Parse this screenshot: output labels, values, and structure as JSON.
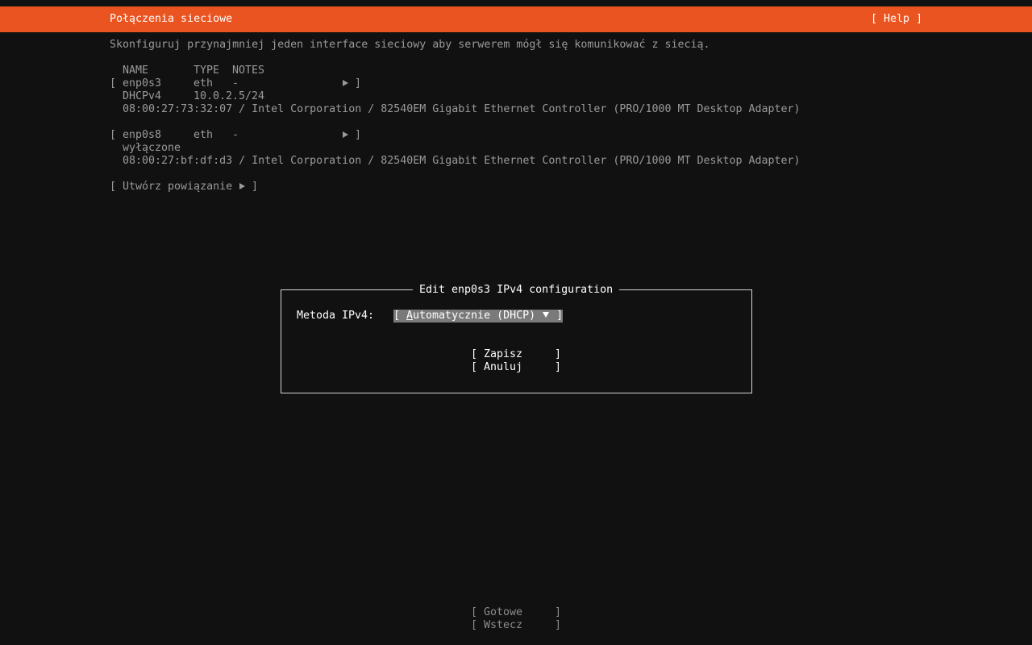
{
  "header": {
    "title": "Połączenia sieciowe",
    "help": "[ Help ]"
  },
  "intro": "Skonfiguruj przynajmniej jeden interface sieciowy aby serwerem mógł się komunikować z siecią.",
  "table": {
    "headers": [
      "NAME",
      "TYPE",
      "NOTES"
    ]
  },
  "interfaces": [
    {
      "name": "enp0s3",
      "type": "eth",
      "notes": "-",
      "addr_method": "DHCPv4",
      "addr": "10.0.2.5/24",
      "hw": "08:00:27:73:32:07 / Intel Corporation / 82540EM Gigabit Ethernet Controller (PRO/1000 MT Desktop Adapter)"
    },
    {
      "name": "enp0s8",
      "type": "eth",
      "notes": "-",
      "status": "wyłączone",
      "hw": "08:00:27:bf:df:d3 / Intel Corporation / 82540EM Gigabit Ethernet Controller (PRO/1000 MT Desktop Adapter)"
    }
  ],
  "create_bond": "Utwórz powiązanie",
  "dialog": {
    "title": "Edit enp0s3 IPv4 configuration",
    "method_label": "Metoda IPv4:",
    "method_value_first": "A",
    "method_value_rest": "utomatycznie (DHCP)",
    "save": "Zapisz",
    "cancel": "Anuluj"
  },
  "footer": {
    "done": "Gotowe",
    "back": "Wstecz"
  },
  "colors": {
    "accent": "#e95420",
    "background": "#111111"
  }
}
